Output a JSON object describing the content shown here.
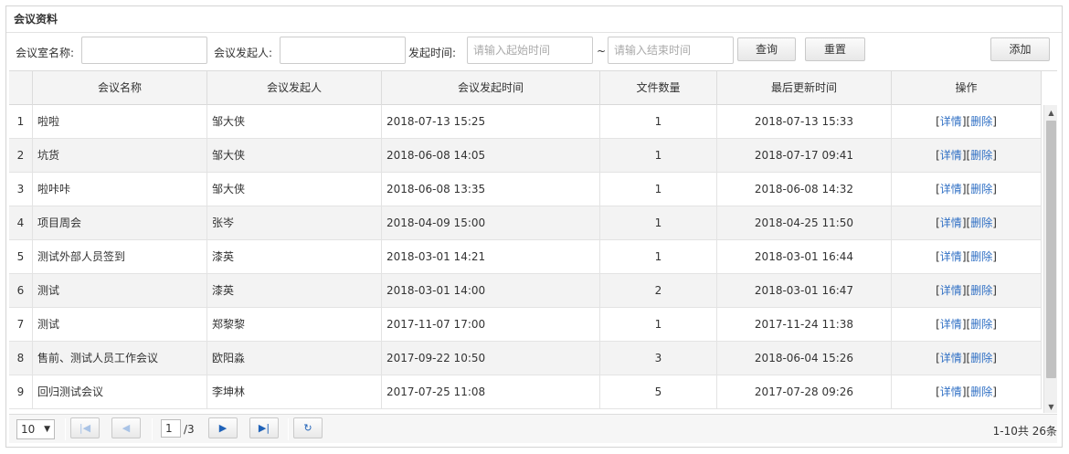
{
  "panel": {
    "title": "会议资料"
  },
  "search": {
    "room_label": "会议室名称:",
    "room_value": "",
    "initiator_label": "会议发起人:",
    "initiator_value": "",
    "time_label": "发起时间:",
    "start_placeholder": "请输入起始时间",
    "range_sep": "~",
    "end_placeholder": "请输入结束时间",
    "query_label": "查询",
    "reset_label": "重置",
    "add_label": "添加"
  },
  "table": {
    "columns": [
      "会议名称",
      "会议发起人",
      "会议发起时间",
      "文件数量",
      "最后更新时间",
      "操作"
    ],
    "op_detail": "详情",
    "op_delete": "删除",
    "rows": [
      {
        "idx": "1",
        "name": "啦啦",
        "initiator": "邹大侠",
        "start": "2018-07-13 15:25",
        "files": "1",
        "updated": "2018-07-13 15:33"
      },
      {
        "idx": "2",
        "name": "坑货",
        "initiator": "邹大侠",
        "start": "2018-06-08 14:05",
        "files": "1",
        "updated": "2018-07-17 09:41"
      },
      {
        "idx": "3",
        "name": "啦咔咔",
        "initiator": "邹大侠",
        "start": "2018-06-08 13:35",
        "files": "1",
        "updated": "2018-06-08 14:32"
      },
      {
        "idx": "4",
        "name": "项目周会",
        "initiator": "张岑",
        "start": "2018-04-09 15:00",
        "files": "1",
        "updated": "2018-04-25 11:50"
      },
      {
        "idx": "5",
        "name": "测试外部人员签到",
        "initiator": "漆英",
        "start": "2018-03-01 14:21",
        "files": "1",
        "updated": "2018-03-01 16:44"
      },
      {
        "idx": "6",
        "name": "测试",
        "initiator": "漆英",
        "start": "2018-03-01 14:00",
        "files": "2",
        "updated": "2018-03-01 16:47"
      },
      {
        "idx": "7",
        "name": "测试",
        "initiator": "郑黎黎",
        "start": "2017-11-07 17:00",
        "files": "1",
        "updated": "2017-11-24 11:38"
      },
      {
        "idx": "8",
        "name": "售前、测试人员工作会议",
        "initiator": "欧阳淼",
        "start": "2017-09-22 10:50",
        "files": "3",
        "updated": "2018-06-04 15:26"
      },
      {
        "idx": "9",
        "name": "回归测试会议",
        "initiator": "李坤林",
        "start": "2017-07-25 11:08",
        "files": "5",
        "updated": "2017-07-28 09:26"
      }
    ]
  },
  "pager": {
    "page_size": "10",
    "current_page": "1",
    "total_pages": "/3",
    "info": "1-10共 26条"
  },
  "icons": {
    "first": "first-page-icon",
    "prev": "prev-page-icon",
    "next": "next-page-icon",
    "last": "last-page-icon",
    "refresh": "refresh-icon"
  },
  "colors": {
    "link": "#2f6fc4",
    "pager_icon_active": "#1f62b8",
    "pager_icon_disabled": "#a9c3e6"
  }
}
